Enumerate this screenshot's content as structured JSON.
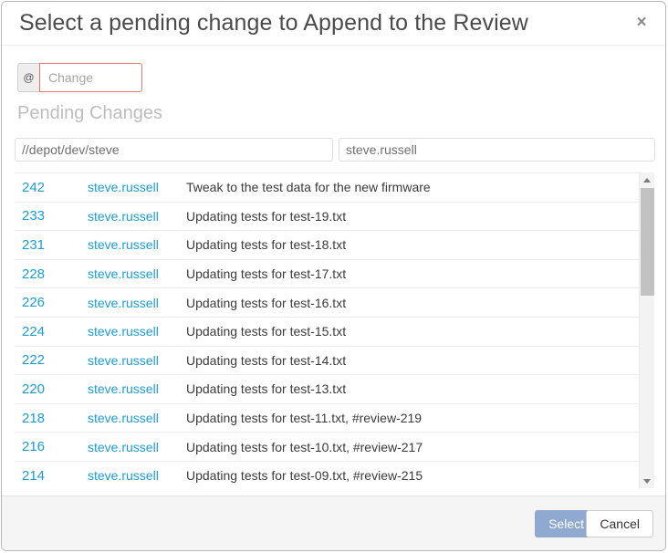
{
  "dialog": {
    "title": "Select a pending change to Append to the Review",
    "close_label": "×"
  },
  "change_field": {
    "addon": "@",
    "value": "",
    "placeholder": "Change",
    "border_color": "#e8796e"
  },
  "section": {
    "heading": "Pending Changes"
  },
  "filters": {
    "path": {
      "value": "//depot/dev/steve",
      "placeholder": "//depot/dev/steve"
    },
    "user": {
      "value": "steve.russell",
      "placeholder": "steve.russell"
    }
  },
  "colors": {
    "link": "#1b9dd9",
    "primary_button": "#8fa9d0",
    "heading": "#bdbdbd"
  },
  "list": {
    "rows": [
      {
        "id": "242",
        "user": "steve.russell",
        "description": "Tweak to the test data for the new firmware"
      },
      {
        "id": "233",
        "user": "steve.russell",
        "description": "Updating tests for test-19.txt"
      },
      {
        "id": "231",
        "user": "steve.russell",
        "description": "Updating tests for test-18.txt"
      },
      {
        "id": "228",
        "user": "steve.russell",
        "description": "Updating tests for test-17.txt"
      },
      {
        "id": "226",
        "user": "steve.russell",
        "description": "Updating tests for test-16.txt"
      },
      {
        "id": "224",
        "user": "steve.russell",
        "description": "Updating tests for test-15.txt"
      },
      {
        "id": "222",
        "user": "steve.russell",
        "description": "Updating tests for test-14.txt"
      },
      {
        "id": "220",
        "user": "steve.russell",
        "description": "Updating tests for test-13.txt"
      },
      {
        "id": "218",
        "user": "steve.russell",
        "description": "Updating tests for test-11.txt, #review-219"
      },
      {
        "id": "216",
        "user": "steve.russell",
        "description": "Updating tests for test-10.txt, #review-217"
      },
      {
        "id": "214",
        "user": "steve.russell",
        "description": "Updating tests for test-09.txt, #review-215"
      }
    ]
  },
  "scrollbar": {
    "up_arrow": "scroll-up",
    "down_arrow": "scroll-down",
    "thumb_position_percent": 0
  },
  "footer": {
    "select_label": "Select",
    "cancel_label": "Cancel"
  }
}
